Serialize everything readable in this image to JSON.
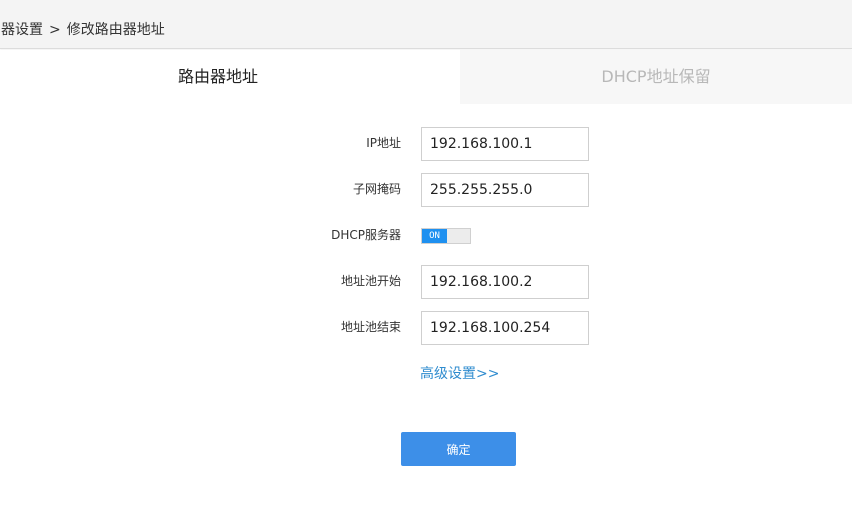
{
  "breadcrumb": {
    "parent": "由器设置",
    "separator": ">",
    "current": "修改路由器地址"
  },
  "tabs": [
    {
      "label": "路由器地址",
      "active": true
    },
    {
      "label": "DHCP地址保留",
      "active": false
    }
  ],
  "form": {
    "ip": {
      "label": "IP地址",
      "value": "192.168.100.1"
    },
    "subnet_mask": {
      "label": "子网掩码",
      "value": "255.255.255.0"
    },
    "dhcp_server": {
      "label": "DHCP服务器",
      "toggle_text": "ON",
      "enabled": true
    },
    "pool_start": {
      "label": "地址池开始",
      "value": "192.168.100.2"
    },
    "pool_end": {
      "label": "地址池结束",
      "value": "192.168.100.254"
    }
  },
  "advanced_link": "高级设置>>",
  "confirm_button": "确定",
  "colors": {
    "accent": "#3d8fe8",
    "toggle_on": "#1e90f0",
    "link": "#2f8ccf",
    "inactive_tab_text": "#b8b8b8"
  }
}
